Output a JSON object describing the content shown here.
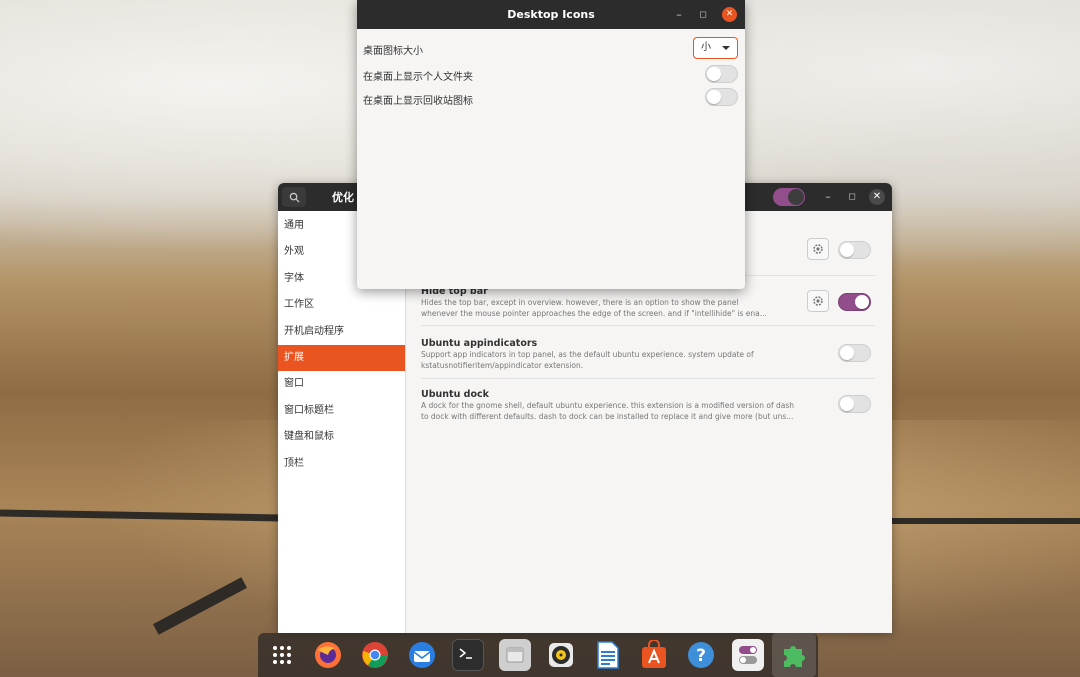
{
  "dialog": {
    "title": "Desktop Icons",
    "controls": {
      "minimize": "–",
      "maximize": "◻",
      "close": "✕"
    },
    "rows": [
      {
        "label": "桌面图标大小",
        "control": "combo",
        "value": "小"
      },
      {
        "label": "在桌面上显示个人文件夹",
        "control": "switch",
        "on": false
      },
      {
        "label": "在桌面上显示回收站图标",
        "control": "switch",
        "on": false
      }
    ]
  },
  "tweaks": {
    "title": "优化",
    "header_toggle_on": true,
    "controls": {
      "minimize": "–",
      "maximize": "◻",
      "close": "✕"
    },
    "sidebar": [
      {
        "label": "通用",
        "active": false
      },
      {
        "label": "外观",
        "active": false
      },
      {
        "label": "字体",
        "active": false
      },
      {
        "label": "工作区",
        "active": false
      },
      {
        "label": "开机启动程序",
        "active": false
      },
      {
        "label": "扩展",
        "active": true
      },
      {
        "label": "窗口",
        "active": false
      },
      {
        "label": "窗口标题栏",
        "active": false
      },
      {
        "label": "键盘和鼠标",
        "active": false
      },
      {
        "label": "顶栏",
        "active": false
      }
    ],
    "extensions": [
      {
        "name": "Hide top bar",
        "desc1": "Hides the top bar, except in overview. however, there is an option to show the panel",
        "desc2": "whenever the mouse pointer approaches the edge of the screen. and if \"intellihide\" is ena...",
        "has_settings": true,
        "on": true
      },
      {
        "name": "Ubuntu appindicators",
        "desc1": "Support app indicators in top panel, as the default ubuntu experience. system update of",
        "desc2": "kstatusnotifieritem/appindicator extension.",
        "has_settings": false,
        "on": false
      },
      {
        "name": "Ubuntu dock",
        "desc1": "A dock for the gnome shell, default ubuntu experience. this extension is a modified version of dash",
        "desc2": "to dock with different defaults. dash to dock can be installed to replace it and give more (but uns...",
        "has_settings": false,
        "on": false
      }
    ],
    "hidden_extension": {
      "has_settings": true,
      "on": false
    }
  },
  "dock": {
    "items": [
      {
        "icon": "app-grid-icon",
        "color": "#ffffff"
      },
      {
        "icon": "firefox-icon",
        "color": "#ff7139"
      },
      {
        "icon": "chrome-icon",
        "color": "#4285f4"
      },
      {
        "icon": "thunderbird-icon",
        "color": "#2a7de1"
      },
      {
        "icon": "terminal-icon",
        "color": "#2d2d2d"
      },
      {
        "icon": "files-icon",
        "color": "#cfcfcf"
      },
      {
        "icon": "rhythmbox-icon",
        "color": "#f0c419"
      },
      {
        "icon": "libreoffice-writer-icon",
        "color": "#2a7fd4"
      },
      {
        "icon": "software-center-icon",
        "color": "#e95420"
      },
      {
        "icon": "help-icon",
        "color": "#3d8fd9"
      },
      {
        "icon": "tweaks-icon",
        "color": "#924d8b"
      },
      {
        "icon": "extensions-puzzle-icon",
        "color": "#4dbb60"
      }
    ],
    "active_index": 11
  },
  "colors": {
    "accent": "#e95420",
    "toggle_on": "#924d8b",
    "header": "#2c2c2c"
  }
}
